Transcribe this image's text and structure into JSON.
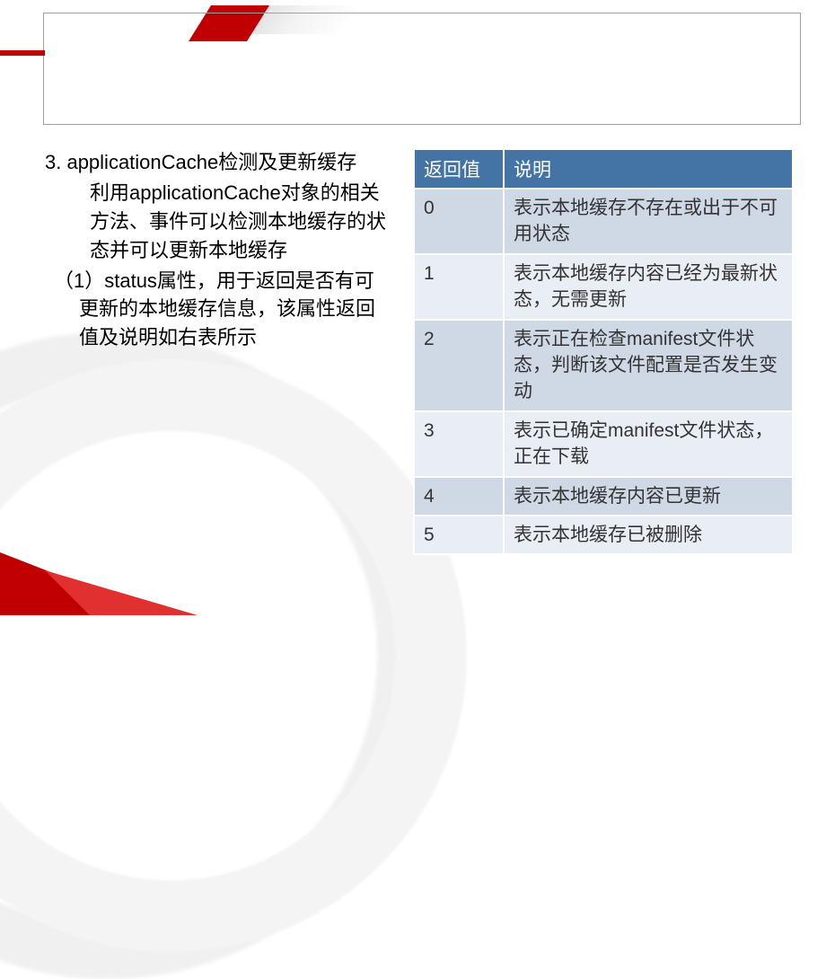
{
  "content": {
    "heading": "3. applicationCache检测及更新缓存",
    "description": "利用applicationCache对象的相关方法、事件可以检测本地缓存的状态并可以更新本地缓存",
    "sub_item": "（1）status属性，用于返回是否有可更新的本地缓存信息，该属性返回值及说明如右表所示"
  },
  "table": {
    "headers": [
      "返回值",
      "说明"
    ],
    "rows": [
      {
        "value": "0",
        "desc": "表示本地缓存不存在或出于不可用状态"
      },
      {
        "value": "1",
        "desc": "表示本地缓存内容已经为最新状态，无需更新"
      },
      {
        "value": "2",
        "desc": "表示正在检查manifest文件状态，判断该文件配置是否发生变动"
      },
      {
        "value": "3",
        "desc": "表示已确定manifest文件状态，正在下载"
      },
      {
        "value": "4",
        "desc": "表示本地缓存内容已更新"
      },
      {
        "value": "5",
        "desc": "表示本地缓存已被删除"
      }
    ]
  }
}
